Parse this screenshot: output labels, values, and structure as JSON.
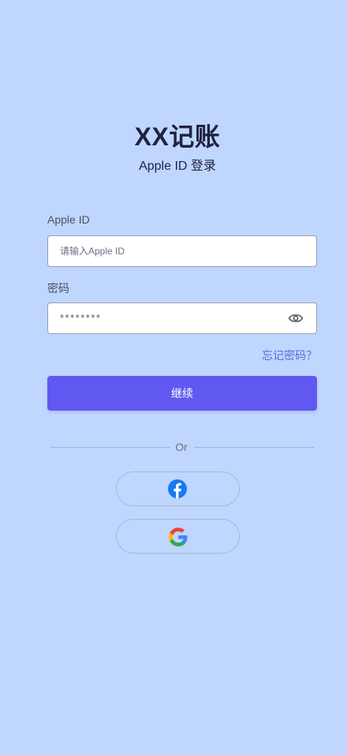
{
  "header": {
    "app_title": "XX记账",
    "subtitle": "Apple ID 登录"
  },
  "form": {
    "apple_id": {
      "label": "Apple ID",
      "placeholder": "请输入Apple ID",
      "value": ""
    },
    "password": {
      "label": "密码",
      "value": "********",
      "toggle_icon": "eye-icon"
    },
    "forgot_password": "忘记密码？",
    "continue_label": "继续"
  },
  "divider": {
    "text": "Or"
  },
  "social": {
    "facebook_icon": "facebook-icon",
    "google_icon": "google-icon"
  },
  "colors": {
    "background": "#bfd6ff",
    "primary": "#6158f2",
    "link": "#5b6ad8",
    "title": "#1f2340"
  }
}
